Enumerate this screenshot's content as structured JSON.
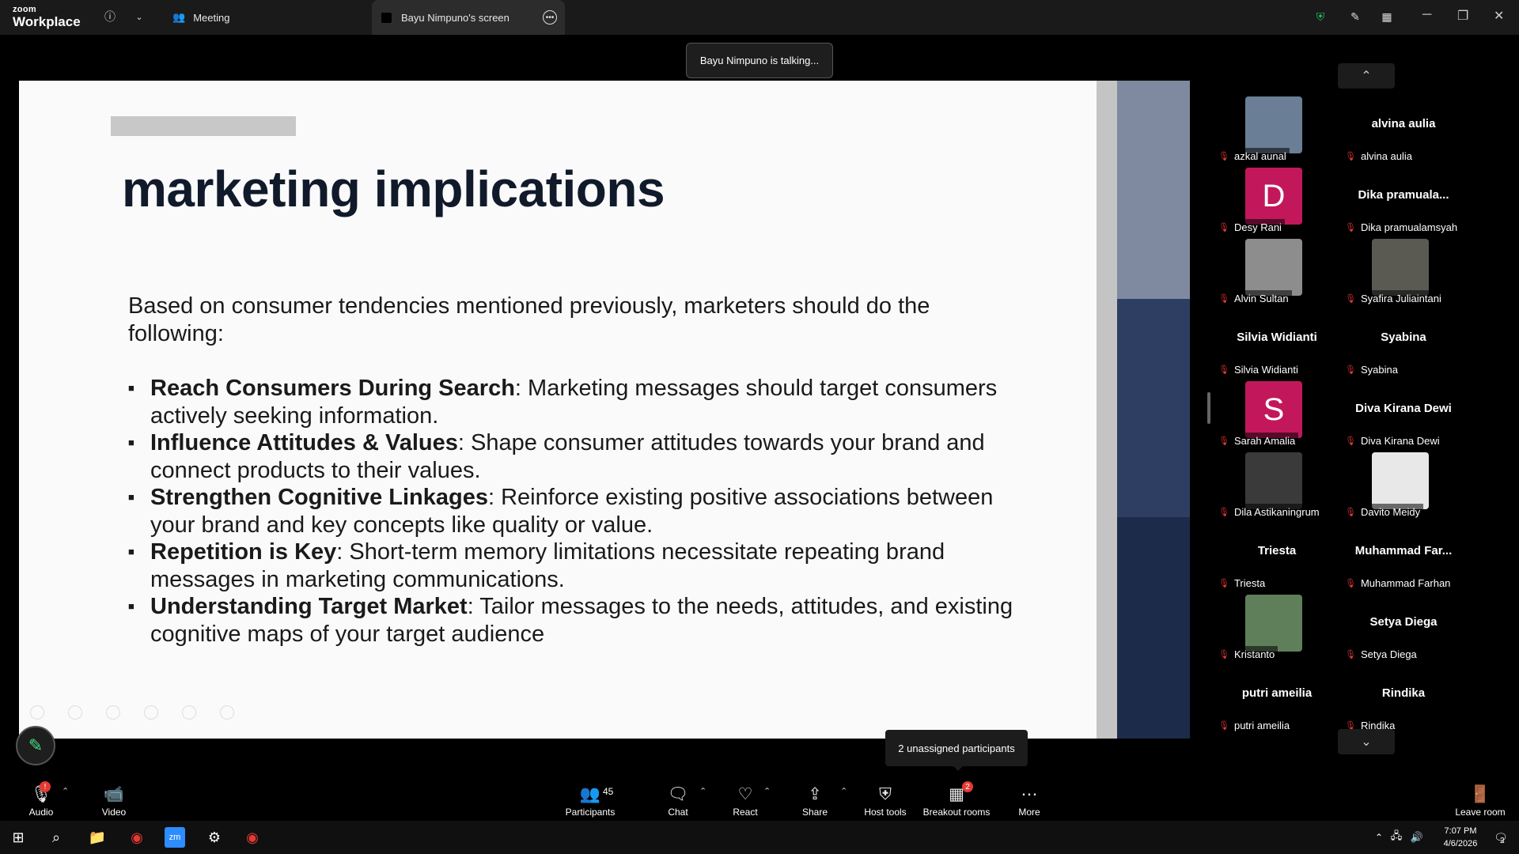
{
  "app": {
    "logo_small": "zoom",
    "logo_big": "Workplace"
  },
  "tabs": {
    "meeting": "Meeting",
    "screen": "Bayu Nimpuno's screen"
  },
  "toast": "Bayu Nimpuno is talking...",
  "slide": {
    "title": "marketing implications",
    "intro": "Based on consumer tendencies mentioned previously, marketers should do the following:",
    "bullets": [
      {
        "bold": "Reach Consumers During Search",
        "text": ": Marketing messages should target consumers actively seeking information."
      },
      {
        "bold": "Influence Attitudes & Values",
        "text": ": Shape consumer attitudes towards your brand and connect products to their values."
      },
      {
        "bold": "Strengthen Cognitive Linkages",
        "text": ": Reinforce existing positive associations between your brand and key concepts like quality or value."
      },
      {
        "bold": "Repetition is Key",
        "text": ": Short-term memory limitations necessitate repeating brand messages in marketing communications."
      },
      {
        "bold": "Understanding Target Market",
        "text": ": Tailor messages to the needs, attitudes, and existing cognitive maps of your target audience"
      }
    ]
  },
  "participants_grid": [
    {
      "name": "azkal aunal",
      "big": "",
      "initial": "",
      "photo": "#6a7f95"
    },
    {
      "name": "alvina aulia",
      "big": "alvina aulia",
      "initial": "",
      "photo": ""
    },
    {
      "name": "Desy Rani",
      "big": "",
      "initial": "D",
      "photo": ""
    },
    {
      "name": "Dika pramualamsyah",
      "big": "Dika  pramuala...",
      "initial": "",
      "photo": ""
    },
    {
      "name": "Alvin Sultan",
      "big": "",
      "initial": "",
      "photo": "#8d8d8d"
    },
    {
      "name": "Syafira Juliaintani",
      "big": "",
      "initial": "",
      "photo": "#5a5a52"
    },
    {
      "name": "Silvia Widianti",
      "big": "Silvia Widianti",
      "initial": "",
      "photo": ""
    },
    {
      "name": "Syabina",
      "big": "Syabina",
      "initial": "",
      "photo": ""
    },
    {
      "name": "Sarah Amalia",
      "big": "",
      "initial": "S",
      "photo": ""
    },
    {
      "name": "Diva Kirana Dewi",
      "big": "Diva Kirana Dewi",
      "initial": "",
      "photo": ""
    },
    {
      "name": "Dila Astikaningrum",
      "big": "",
      "initial": "",
      "photo": "#3a3a3a"
    },
    {
      "name": "Davito Meidy",
      "big": "",
      "initial": "",
      "photo": "#e8e8e8"
    },
    {
      "name": "Triesta",
      "big": "Triesta",
      "initial": "",
      "photo": ""
    },
    {
      "name": "Muhammad Farhan",
      "big": "Muhammad  Far...",
      "initial": "",
      "photo": ""
    },
    {
      "name": "Kristanto",
      "big": "",
      "initial": "",
      "photo": "#5f7f5a"
    },
    {
      "name": "Setya Diega",
      "big": "Setya Diega",
      "initial": "",
      "photo": ""
    },
    {
      "name": "putri ameilia",
      "big": "putri ameilia",
      "initial": "",
      "photo": ""
    },
    {
      "name": "Rindika",
      "big": "Rindika",
      "initial": "",
      "photo": ""
    }
  ],
  "toolbar": {
    "audio": "Audio",
    "video": "Video",
    "participants": "Participants",
    "participants_count": "45",
    "chat": "Chat",
    "react": "React",
    "share": "Share",
    "host_tools": "Host tools",
    "breakout": "Breakout rooms",
    "breakout_badge": "2",
    "more": "More",
    "leave": "Leave room"
  },
  "tooltip": "2 unassigned participants",
  "clock": {
    "time": "7:07 PM",
    "date": "4/6/2026"
  },
  "notification_count": "2"
}
